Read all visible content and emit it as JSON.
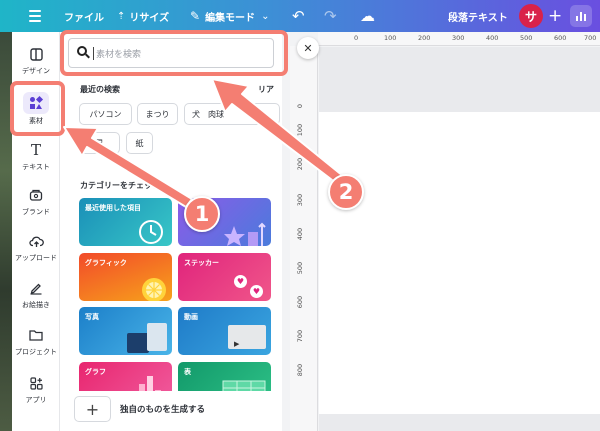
{
  "topbar": {
    "file_label": "ファイル",
    "resize_label": "リサイズ",
    "edit_mode_label": "編集モード",
    "doc_title": "段落テキスト",
    "avatar_initial": "サ"
  },
  "sidebar": {
    "items": [
      {
        "label": "デザイン",
        "icon": "layout-icon"
      },
      {
        "label": "素材",
        "icon": "shapes-icon",
        "active": true
      },
      {
        "label": "テキスト",
        "icon": "text-icon"
      },
      {
        "label": "ブランド",
        "icon": "brand-icon"
      },
      {
        "label": "アップロード",
        "icon": "upload-icon"
      },
      {
        "label": "お絵描き",
        "icon": "draw-icon"
      },
      {
        "label": "プロジェクト",
        "icon": "folder-icon"
      },
      {
        "label": "アプリ",
        "icon": "apps-icon"
      }
    ]
  },
  "panel": {
    "search": {
      "placeholder": "素材を検索"
    },
    "recent": {
      "title": "最近の検索",
      "clear_label": "リア",
      "chips": [
        "パソコン",
        "まつり",
        "犬　肉球",
        "星",
        "紙"
      ]
    },
    "categories": {
      "title": "カテゴリーをチェック",
      "tiles": [
        {
          "label": "最近使用した項目"
        },
        {
          "label": ""
        },
        {
          "label": "グラフィック"
        },
        {
          "label": "ステッカー"
        },
        {
          "label": "写真"
        },
        {
          "label": "動画"
        },
        {
          "label": "グラフ"
        },
        {
          "label": "表"
        }
      ]
    },
    "generate_label": "独自のものを生成する"
  },
  "ruler": {
    "top": [
      "0",
      "100",
      "200",
      "300",
      "400",
      "500",
      "600",
      "700"
    ],
    "left": [
      "0",
      "100",
      "200",
      "300",
      "400",
      "500",
      "600",
      "700",
      "800"
    ]
  },
  "annotations": {
    "step1": "1",
    "step2": "2",
    "color": "#f47e72"
  },
  "colors": {
    "accent": "#5b3fd4",
    "topbar_start": "#1fb5c8",
    "topbar_end": "#6a4fe0"
  }
}
